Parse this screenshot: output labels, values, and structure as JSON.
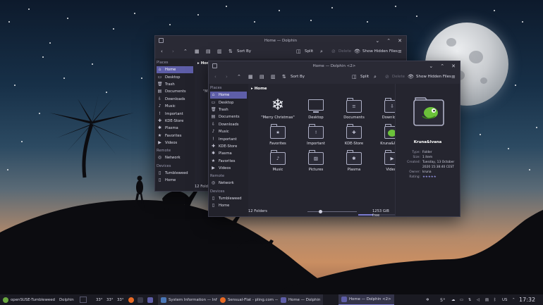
{
  "windows": {
    "back": {
      "title": "Home — Dolphin",
      "toolbar": {
        "sort_label": "Sort By",
        "split_label": "Split",
        "delete_label": "Delete",
        "hidden_label": "Show Hidden Files"
      },
      "breadcrumb": "Home",
      "places_label": "Places",
      "places": [
        "Home",
        "Desktop",
        "Trash",
        "Documents",
        "Downloads",
        "Music",
        "Important",
        "KDE-Store",
        "Plasma",
        "Favorites",
        "Videos"
      ],
      "remote_label": "Remote",
      "remote": [
        "Network"
      ],
      "devices_label": "Devices",
      "devices": [
        "Tumbleweed",
        "Home"
      ],
      "status_partial": "12 Folders",
      "peek_text": "\"Me"
    },
    "front": {
      "title": "Home — Dolphin <2>",
      "toolbar": {
        "sort_label": "Sort By",
        "split_label": "Split",
        "delete_label": "Delete",
        "hidden_label": "Show Hidden Files"
      },
      "breadcrumb": "Home",
      "places_label": "Places",
      "places": [
        "Home",
        "Desktop",
        "Trash",
        "Documents",
        "Downloads",
        "Music",
        "Important",
        "KDE-Store",
        "Plasma",
        "Favorites",
        "Videos"
      ],
      "remote_label": "Remote",
      "remote": [
        "Network"
      ],
      "devices_label": "Devices",
      "devices": [
        "Tumbleweed",
        "Home"
      ],
      "folders": [
        {
          "name": "\"Merry Christmas\"",
          "icon": "snowflake-icon"
        },
        {
          "name": "Desktop",
          "icon": "desktop-icon"
        },
        {
          "name": "Documents",
          "icon": "documents-folder-icon"
        },
        {
          "name": "Downloads",
          "icon": "downloads-folder-icon"
        },
        {
          "name": "Favorites",
          "icon": "favorites-folder-icon"
        },
        {
          "name": "Important",
          "icon": "important-folder-icon"
        },
        {
          "name": "KDE-Store",
          "icon": "store-folder-icon"
        },
        {
          "name": "Kruna&Ivana",
          "icon": "chameleon-folder-icon"
        },
        {
          "name": "Music",
          "icon": "music-folder-icon"
        },
        {
          "name": "Pictures",
          "icon": "pictures-folder-icon"
        },
        {
          "name": "Plasma",
          "icon": "plasma-folder-icon"
        },
        {
          "name": "Videos",
          "icon": "videos-folder-icon"
        }
      ],
      "status": {
        "count": "12 Folders",
        "free": "1253 GiB free",
        "zoom_fraction": 0.25,
        "free_fraction": 0.3
      },
      "info": {
        "name": "Kruna&Ivana",
        "rows": [
          {
            "k": "Type:",
            "v": "Folder"
          },
          {
            "k": "Size:",
            "v": "1 item"
          },
          {
            "k": "Created:",
            "v": "Tuesday, 13 October 2020 15:38:40 CEST"
          },
          {
            "k": "Owner:",
            "v": "kruna"
          },
          {
            "k": "Rating:",
            "v": "★★★★★"
          }
        ]
      }
    }
  },
  "taskbar": {
    "launcher_label": "openSUSE-Tumbleweed",
    "app_label": "Dolphin",
    "temps": [
      "33°",
      "33°",
      "33°"
    ],
    "tasks": [
      {
        "label": "System Information — Info Cen…"
      },
      {
        "label": "Sensual-Flat - pling.com — Moz…"
      },
      {
        "label": "Home — Dolphin"
      },
      {
        "label": "Home — Dolphin <2>"
      }
    ],
    "weather": "5°",
    "keyboard": "US",
    "clock": "17:32"
  },
  "colors": {
    "accent": "#5e5ea8",
    "window_bg": "#25252f",
    "taskbar_bg": "#1a1a22"
  }
}
